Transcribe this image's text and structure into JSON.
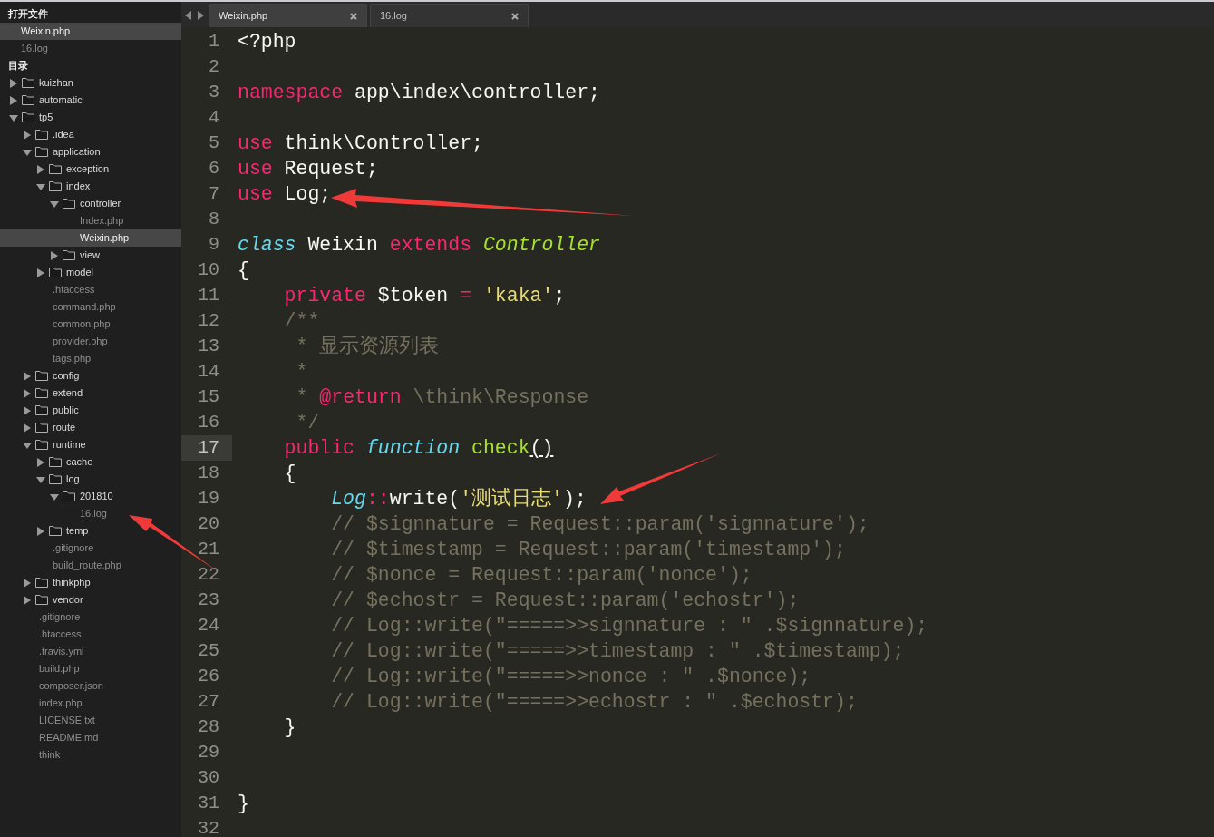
{
  "sidebar": {
    "open_files_heading": "打开文件",
    "open_files": [
      {
        "name": "Weixin.php",
        "selected": true
      },
      {
        "name": "16.log",
        "selected": false
      }
    ],
    "folders_heading": "目录",
    "tree": [
      {
        "kind": "folder",
        "name": "kuizhan",
        "expanded": false
      },
      {
        "kind": "folder",
        "name": "automatic",
        "expanded": false
      },
      {
        "kind": "folder",
        "name": "tp5",
        "expanded": true,
        "children": [
          {
            "kind": "folder",
            "name": ".idea",
            "expanded": false
          },
          {
            "kind": "folder",
            "name": "application",
            "expanded": true,
            "children": [
              {
                "kind": "folder",
                "name": "exception",
                "expanded": false
              },
              {
                "kind": "folder",
                "name": "index",
                "expanded": true,
                "children": [
                  {
                    "kind": "folder",
                    "name": "controller",
                    "expanded": true,
                    "children": [
                      {
                        "kind": "file",
                        "name": "Index.php",
                        "selected": false
                      },
                      {
                        "kind": "file",
                        "name": "Weixin.php",
                        "selected": true
                      }
                    ]
                  },
                  {
                    "kind": "folder",
                    "name": "view",
                    "expanded": false
                  }
                ]
              },
              {
                "kind": "folder",
                "name": "model",
                "expanded": false
              },
              {
                "kind": "file",
                "name": ".htaccess",
                "selected": false
              },
              {
                "kind": "file",
                "name": "command.php",
                "selected": false
              },
              {
                "kind": "file",
                "name": "common.php",
                "selected": false
              },
              {
                "kind": "file",
                "name": "provider.php",
                "selected": false
              },
              {
                "kind": "file",
                "name": "tags.php",
                "selected": false
              }
            ]
          },
          {
            "kind": "folder",
            "name": "config",
            "expanded": false
          },
          {
            "kind": "folder",
            "name": "extend",
            "expanded": false
          },
          {
            "kind": "folder",
            "name": "public",
            "expanded": false
          },
          {
            "kind": "folder",
            "name": "route",
            "expanded": false
          },
          {
            "kind": "folder",
            "name": "runtime",
            "expanded": true,
            "children": [
              {
                "kind": "folder",
                "name": "cache",
                "expanded": false
              },
              {
                "kind": "folder",
                "name": "log",
                "expanded": true,
                "children": [
                  {
                    "kind": "folder",
                    "name": "201810",
                    "expanded": true,
                    "children": [
                      {
                        "kind": "file",
                        "name": "16.log",
                        "selected": false
                      }
                    ]
                  }
                ]
              },
              {
                "kind": "folder",
                "name": "temp",
                "expanded": false
              },
              {
                "kind": "file",
                "name": ".gitignore",
                "selected": false
              },
              {
                "kind": "file",
                "name": "build_route.php",
                "selected": false
              }
            ]
          },
          {
            "kind": "folder",
            "name": "thinkphp",
            "expanded": false
          },
          {
            "kind": "folder",
            "name": "vendor",
            "expanded": false
          },
          {
            "kind": "file",
            "name": ".gitignore",
            "selected": false
          },
          {
            "kind": "file",
            "name": ".htaccess",
            "selected": false
          },
          {
            "kind": "file",
            "name": ".travis.yml",
            "selected": false
          },
          {
            "kind": "file",
            "name": "build.php",
            "selected": false
          },
          {
            "kind": "file",
            "name": "composer.json",
            "selected": false
          },
          {
            "kind": "file",
            "name": "index.php",
            "selected": false
          },
          {
            "kind": "file",
            "name": "LICENSE.txt",
            "selected": false
          },
          {
            "kind": "file",
            "name": "README.md",
            "selected": false
          },
          {
            "kind": "file",
            "name": "think",
            "selected": false
          }
        ]
      }
    ]
  },
  "tabs": [
    {
      "label": "Weixin.php",
      "selected": true
    },
    {
      "label": "16.log",
      "selected": false
    }
  ],
  "editor": {
    "lines": [
      {
        "number": "1",
        "current": false,
        "tokens": [
          {
            "kind": "plain",
            "text": "<?php"
          }
        ]
      },
      {
        "number": "2",
        "current": false
      },
      {
        "number": "3",
        "current": false,
        "tokens": [
          {
            "kind": "keyword",
            "text": "namespace"
          },
          {
            "kind": "plain",
            "text": " app\\index\\controller;"
          }
        ]
      },
      {
        "number": "4",
        "current": false
      },
      {
        "number": "5",
        "current": false,
        "tokens": [
          {
            "kind": "keyword",
            "text": "use"
          },
          {
            "kind": "plain",
            "text": " think\\Controller;"
          }
        ]
      },
      {
        "number": "6",
        "current": false,
        "tokens": [
          {
            "kind": "keyword",
            "text": "use"
          },
          {
            "kind": "plain",
            "text": " Request;"
          }
        ]
      },
      {
        "number": "7",
        "current": false,
        "tokens": [
          {
            "kind": "keyword",
            "text": "use"
          },
          {
            "kind": "plain",
            "text": " Log;"
          }
        ]
      },
      {
        "number": "8",
        "current": false
      },
      {
        "number": "9",
        "current": false,
        "tokens": [
          {
            "kind": "storage",
            "text": "class"
          },
          {
            "kind": "plain",
            "text": " Weixin "
          },
          {
            "kind": "keyword",
            "text": "extends"
          },
          {
            "kind": "inherited",
            "text": " Controller"
          }
        ]
      },
      {
        "number": "10",
        "current": false,
        "tokens": [
          {
            "kind": "plain",
            "text": "{"
          }
        ]
      },
      {
        "number": "11",
        "current": false,
        "tokens": [
          {
            "kind": "keyword",
            "text": "    private"
          },
          {
            "kind": "plain",
            "text": " $token "
          },
          {
            "kind": "keyword",
            "text": "="
          },
          {
            "kind": "string",
            "text": " 'kaka'"
          },
          {
            "kind": "plain",
            "text": ";"
          }
        ]
      },
      {
        "number": "12",
        "current": false,
        "tokens": [
          {
            "kind": "comment",
            "text": "    /**"
          }
        ]
      },
      {
        "number": "13",
        "current": false,
        "tokens": [
          {
            "kind": "comment",
            "text": "     * 显示资源列表"
          }
        ]
      },
      {
        "number": "14",
        "current": false,
        "tokens": [
          {
            "kind": "comment",
            "text": "     *"
          }
        ]
      },
      {
        "number": "15",
        "current": false,
        "tokens": [
          {
            "kind": "comment",
            "text": "     * "
          },
          {
            "kind": "keyword",
            "text": "@return"
          },
          {
            "kind": "comment",
            "text": " \\think\\Response"
          }
        ]
      },
      {
        "number": "16",
        "current": false,
        "tokens": [
          {
            "kind": "comment",
            "text": "     */"
          }
        ]
      },
      {
        "number": "17",
        "current": true,
        "tokens": [
          {
            "kind": "keyword",
            "text": "    public"
          },
          {
            "kind": "storage",
            "text": " function"
          },
          {
            "kind": "function",
            "text": " check"
          },
          {
            "kind": "match",
            "text": "()"
          }
        ]
      },
      {
        "number": "18",
        "current": false,
        "tokens": [
          {
            "kind": "plain",
            "text": "    {"
          }
        ]
      },
      {
        "number": "19",
        "current": false,
        "tokens": [
          {
            "kind": "storage",
            "text": "        Log"
          },
          {
            "kind": "keyword",
            "text": "::"
          },
          {
            "kind": "plain",
            "text": "write("
          },
          {
            "kind": "string",
            "text": "'测试日志'"
          },
          {
            "kind": "plain",
            "text": ");"
          }
        ]
      },
      {
        "number": "20",
        "current": false,
        "tokens": [
          {
            "kind": "comment",
            "text": "        // $signnature = Request::param('signnature');"
          }
        ]
      },
      {
        "number": "21",
        "current": false,
        "tokens": [
          {
            "kind": "comment",
            "text": "        // $timestamp = Request::param('timestamp');"
          }
        ]
      },
      {
        "number": "22",
        "current": false,
        "tokens": [
          {
            "kind": "comment",
            "text": "        // $nonce = Request::param('nonce');"
          }
        ]
      },
      {
        "number": "23",
        "current": false,
        "tokens": [
          {
            "kind": "comment",
            "text": "        // $echostr = Request::param('echostr');"
          }
        ]
      },
      {
        "number": "24",
        "current": false,
        "tokens": [
          {
            "kind": "comment",
            "text": "        // Log::write(\"=====>>signnature : \" .$signnature);"
          }
        ]
      },
      {
        "number": "25",
        "current": false,
        "tokens": [
          {
            "kind": "comment",
            "text": "        // Log::write(\"=====>>timestamp : \" .$timestamp);"
          }
        ]
      },
      {
        "number": "26",
        "current": false,
        "tokens": [
          {
            "kind": "comment",
            "text": "        // Log::write(\"=====>>nonce : \" .$nonce);"
          }
        ]
      },
      {
        "number": "27",
        "current": false,
        "tokens": [
          {
            "kind": "comment",
            "text": "        // Log::write(\"=====>>echostr : \" .$echostr);"
          }
        ]
      },
      {
        "number": "28",
        "current": false,
        "tokens": [
          {
            "kind": "plain",
            "text": "    }"
          }
        ]
      },
      {
        "number": "29",
        "current": false
      },
      {
        "number": "30",
        "current": false
      },
      {
        "number": "31",
        "current": false,
        "tokens": [
          {
            "kind": "plain",
            "text": "}"
          }
        ]
      },
      {
        "number": "32",
        "current": false
      }
    ]
  }
}
